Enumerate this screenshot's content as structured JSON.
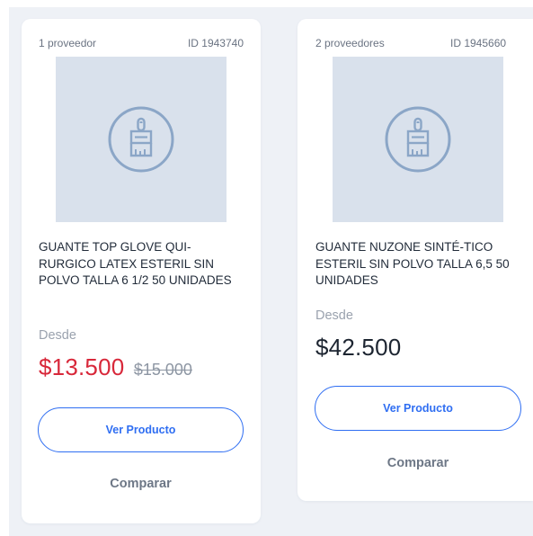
{
  "products": [
    {
      "providers": "1 proveedor",
      "id_label": "ID 1943740",
      "title": "GUANTE TOP GLOVE QUI-RURGICO LATEX ESTERIL SIN POLVO TALLA 6 1/2 50 UNIDADES",
      "from_label": "Desde",
      "price": "$13.500",
      "old_price": "$15.000",
      "view_button": "Ver Producto",
      "compare_label": "Comparar",
      "image_icon": "paint-brush-icon",
      "price_color": "#d8283a"
    },
    {
      "providers": "2 proveedores",
      "id_label": "ID 1945660",
      "title": "GUANTE NUZONE SINTÉ-TICO ESTERIL SIN POLVO TALLA 6,5 50 UNIDADES",
      "from_label": "Desde",
      "price": "$42.500",
      "view_button": "Ver Producto",
      "compare_label": "Comparar",
      "image_icon": "paint-brush-icon",
      "price_color": "#1d2531"
    }
  ],
  "colors": {
    "accent": "#2f6ef2",
    "placeholder_bg": "#d9e1ec",
    "icon_stroke": "#8ba6c7"
  }
}
